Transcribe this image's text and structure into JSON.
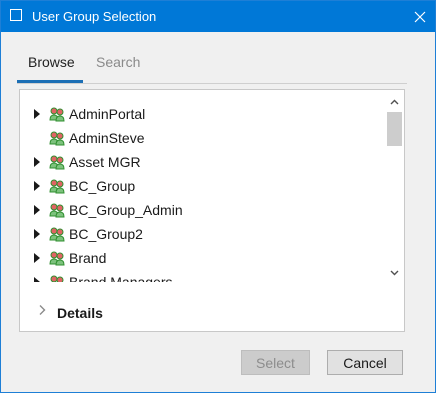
{
  "window": {
    "title": "User Group Selection",
    "close_icon": "close-icon"
  },
  "tabs": [
    {
      "label": "Browse",
      "active": true
    },
    {
      "label": "Search",
      "active": false
    }
  ],
  "tree": {
    "items": [
      {
        "label": "AdminPortal",
        "expandable": true
      },
      {
        "label": "AdminSteve",
        "expandable": false
      },
      {
        "label": "Asset MGR",
        "expandable": true
      },
      {
        "label": "BC_Group",
        "expandable": true
      },
      {
        "label": "BC_Group_Admin",
        "expandable": true
      },
      {
        "label": "BC_Group2",
        "expandable": true
      },
      {
        "label": "Brand",
        "expandable": true
      },
      {
        "label": "Brand Managers",
        "expandable": true
      }
    ]
  },
  "details": {
    "label": "Details"
  },
  "buttons": {
    "select": "Select",
    "cancel": "Cancel"
  },
  "colors": {
    "titlebar": "#0078d7",
    "tab_accent": "#1c6fb5"
  }
}
